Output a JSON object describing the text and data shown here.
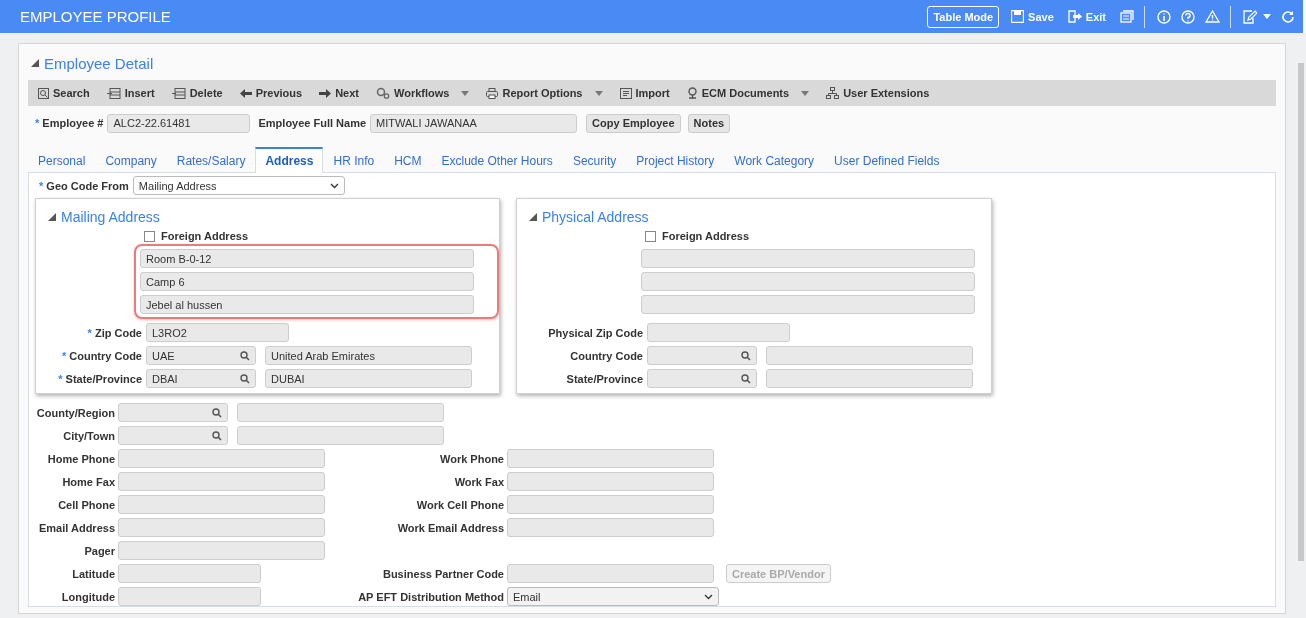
{
  "header": {
    "title": "EMPLOYEE PROFILE",
    "table_mode": "Table Mode",
    "save": "Save",
    "exit": "Exit"
  },
  "section": {
    "title": "Employee Detail",
    "expanded": true
  },
  "toolbar": [
    {
      "label": "Search",
      "has_menu": false
    },
    {
      "label": "Insert",
      "has_menu": false
    },
    {
      "label": "Delete",
      "has_menu": false
    },
    {
      "label": "Previous",
      "has_menu": false
    },
    {
      "label": "Next",
      "has_menu": false
    },
    {
      "label": "Workflows",
      "has_menu": true
    },
    {
      "label": "Report Options",
      "has_menu": true
    },
    {
      "label": "Import",
      "has_menu": false
    },
    {
      "label": "ECM Documents",
      "has_menu": true
    },
    {
      "label": "User Extensions",
      "has_menu": false
    }
  ],
  "employee": {
    "number_label": "Employee #",
    "number_required": "*",
    "number": "ALC2-22.61481",
    "name_label": "Employee Full Name",
    "name": "MITWALI JAWANAA",
    "buttons": [
      "Copy Employee",
      "Notes"
    ]
  },
  "tabs": [
    {
      "label": "Personal",
      "selected": false
    },
    {
      "label": "Company",
      "selected": false
    },
    {
      "label": "Rates/Salary",
      "selected": false
    },
    {
      "label": "Address",
      "selected": true
    },
    {
      "label": "HR Info",
      "selected": false
    },
    {
      "label": "HCM",
      "selected": false
    },
    {
      "label": "Exclude Other Hours",
      "selected": false
    },
    {
      "label": "Security",
      "selected": false
    },
    {
      "label": "Project History",
      "selected": false
    },
    {
      "label": "Work Category",
      "selected": false
    },
    {
      "label": "User Defined Fields",
      "selected": false
    }
  ],
  "geo_code": {
    "label": "Geo Code From",
    "required": "*",
    "value": "Mailing Address"
  },
  "address_boxes": [
    {
      "title": "Mailing Address",
      "expanded": true,
      "foreign_label": "Foreign Address",
      "foreign_checked": false,
      "highlighted": true,
      "lines": [
        {
          "kind": "text",
          "value": "Room B-0-12"
        },
        {
          "kind": "text",
          "value": "Camp 6"
        },
        {
          "kind": "text",
          "value": "Jebel al hussen"
        }
      ],
      "fields": [
        {
          "label": "Zip Code",
          "required": "*",
          "kind": "short",
          "value": "L3RO2"
        },
        {
          "label": "Country Code",
          "required": "*",
          "kind": "lookup",
          "value": "UAE",
          "description": "United Arab Emirates"
        },
        {
          "label": "State/Province",
          "required": "*",
          "kind": "lookup",
          "value": "DBAI",
          "description": "DUBAI"
        }
      ]
    },
    {
      "title": "Physical Address",
      "expanded": true,
      "foreign_label": "Foreign Address",
      "foreign_checked": false,
      "highlighted": false,
      "lines": [
        {
          "kind": "blank"
        },
        {
          "kind": "blank"
        },
        {
          "kind": "blank"
        }
      ],
      "fields": [
        {
          "label": "Physical Zip Code",
          "kind": "short"
        },
        {
          "label": "Country Code",
          "kind": "lookup"
        },
        {
          "label": "State/Province",
          "kind": "lookup"
        }
      ]
    }
  ],
  "rows": [
    {
      "left": {
        "label": "County/Region",
        "kind": "lookup"
      }
    },
    {
      "left": {
        "label": "City/Town",
        "kind": "lookup"
      }
    },
    {
      "left": {
        "label": "Home Phone",
        "kind": "text"
      },
      "right": {
        "label": "Work Phone",
        "kind": "text"
      }
    },
    {
      "left": {
        "label": "Home Fax",
        "kind": "text"
      },
      "right": {
        "label": "Work Fax",
        "kind": "text"
      }
    },
    {
      "left": {
        "label": "Cell Phone",
        "kind": "text"
      },
      "right": {
        "label": "Work Cell Phone",
        "kind": "text"
      }
    },
    {
      "left": {
        "label": "Email Address",
        "kind": "text"
      },
      "right": {
        "label": "Work Email Address",
        "kind": "text"
      }
    },
    {
      "left": {
        "label": "Pager",
        "kind": "text"
      }
    },
    {
      "left": {
        "label": "Latitude",
        "kind": "short"
      },
      "right": {
        "label": "Business Partner Code",
        "kind": "text",
        "button": {
          "label": "Create BP/Vendor",
          "disabled": true
        }
      }
    },
    {
      "left": {
        "label": "Longitude",
        "kind": "short"
      },
      "right": {
        "label": "AP EFT Distribution Method",
        "kind": "select",
        "value": "Email"
      }
    }
  ]
}
